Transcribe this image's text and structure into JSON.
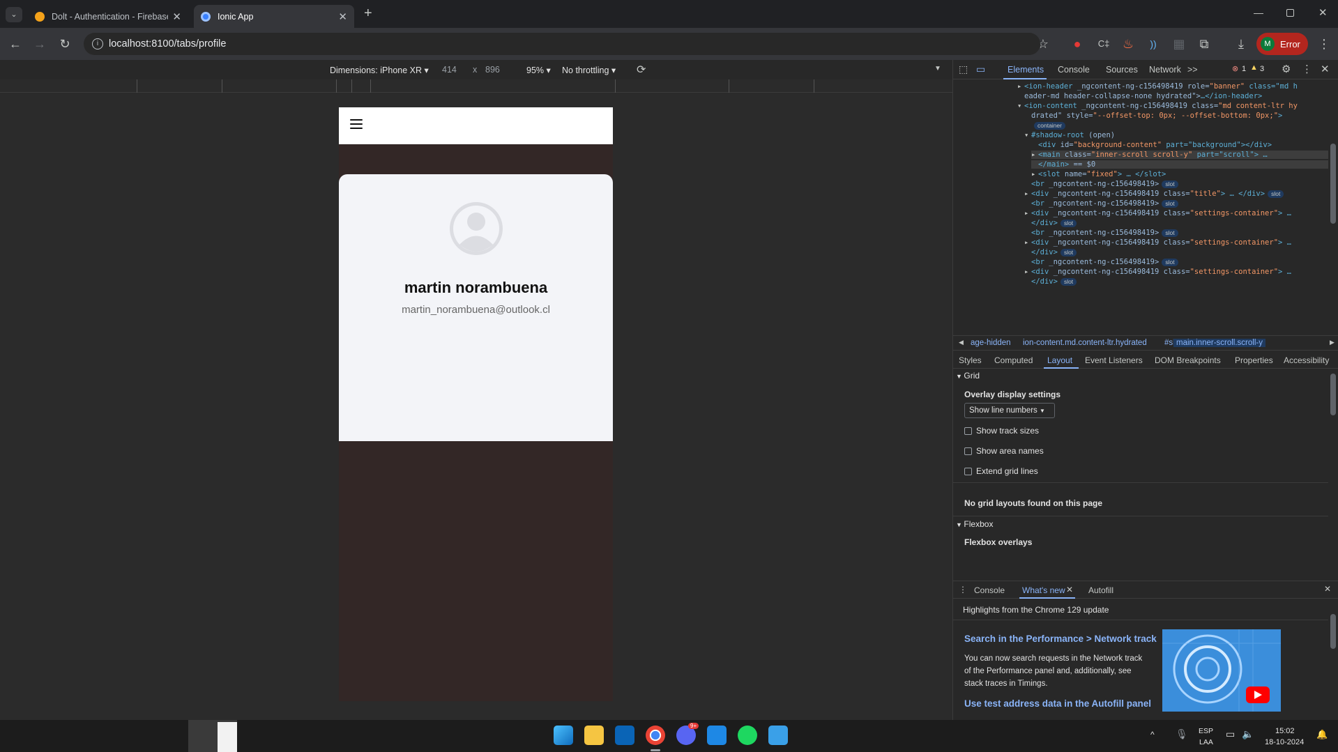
{
  "browser": {
    "tabs": [
      {
        "title": "Dolt - Authentication - Firebase",
        "active": false
      },
      {
        "title": "Ionic App",
        "active": true
      }
    ],
    "new_tab_symbol": "+",
    "url": "localhost:8100/tabs/profile",
    "profile_initial": "M",
    "profile_status": "Error"
  },
  "device_toolbar": {
    "device": "Dimensions: iPhone XR ▾",
    "width": "414",
    "times": "x",
    "height": "896",
    "zoom": "95% ▾",
    "throttling": "No throttling ▾"
  },
  "app": {
    "user_name": "martin norambuena",
    "user_email": "martin_norambuena@outlook.cl"
  },
  "devtools": {
    "tabs": [
      "Elements",
      "Console",
      "Sources",
      "Network"
    ],
    "more_tabs": ">>",
    "error_count": "1",
    "warning_count": "3",
    "breadcrumbs": [
      "age-hidden",
      "ion-content.md.content-ltr.hydrated",
      "#shadow-root",
      "main.inner-scroll.scroll-y"
    ],
    "subtabs": [
      "Styles",
      "Computed",
      "Layout",
      "Event Listeners",
      "DOM Breakpoints",
      "Properties",
      "Accessibility"
    ],
    "layout": {
      "grid_header": "Grid",
      "overlay_title": "Overlay display settings",
      "select_value": "Show line numbers",
      "checkboxes": [
        "Show track sizes",
        "Show area names",
        "Extend grid lines"
      ],
      "no_grid": "No grid layouts found on this page",
      "flexbox_header": "Flexbox",
      "flexbox_overlays": "Flexbox overlays"
    },
    "drawer_tabs": [
      "Console",
      "What's new",
      "Autofill"
    ],
    "whatsnew": {
      "highlights": "Highlights from the Chrome 129 update",
      "item1_title": "Search in the Performance > Network track",
      "item1_body": "You can now search requests in the Network track of the Performance panel and, additionally, see stack traces in Timings.",
      "item2_title": "Use test address data in the Autofill panel"
    },
    "dom": [
      {
        "pre": "▸",
        "tag": "<ion-header",
        "attrs": " _ngcontent-ng-c156498419 role=",
        "val": "\"banner\"",
        "rest": " class=\"md h"
      },
      {
        "pre": "",
        "tag": "",
        "attrs": "eader-md header-collapse-none hydrated\">",
        "val": "",
        "rest": "…</ion-header>"
      },
      {
        "pre": "▾",
        "tag": "<ion-content",
        "attrs": " _ngcontent-ng-c156498419 class=",
        "val": "\"md content-ltr hy",
        "rest": ""
      },
      {
        "pre": "",
        "tag": "",
        "attrs": "drated\" style=",
        "val": "\"--offset-top: 0px; --offset-bottom: 0px;\"",
        "rest": ">"
      },
      {
        "pre": "",
        "tag": "",
        "attrs": "",
        "val": "",
        "rest": "",
        "badge": "container"
      },
      {
        "pre": "▾",
        "tag": "#shadow-root",
        "attrs": " (open)",
        "val": "",
        "rest": ""
      },
      {
        "pre": "",
        "tag": "<div",
        "attrs": " id=",
        "val": "\"background-content\"",
        "rest": " part=\"background\"></div>"
      },
      {
        "pre": "▸",
        "tag": "<main",
        "attrs": " class=",
        "val": "\"inner-scroll scroll-y\"",
        "rest": " part=\"scroll\"> …"
      },
      {
        "pre": "",
        "tag": "</main>",
        "attrs": " == $0",
        "val": "",
        "rest": ""
      },
      {
        "pre": "▸",
        "tag": "<slot",
        "attrs": " name=",
        "val": "\"fixed\"",
        "rest": "> … </slot>"
      },
      {
        "pre": "",
        "tag": "<br",
        "attrs": " _ngcontent-ng-c156498419>",
        "val": "",
        "rest": "",
        "badge": "slot"
      },
      {
        "pre": "▸",
        "tag": "<div",
        "attrs": " _ngcontent-ng-c156498419 class=",
        "val": "\"title\"",
        "rest": "> … </div>",
        "badge": "slot"
      },
      {
        "pre": "",
        "tag": "<br",
        "attrs": " _ngcontent-ng-c156498419>",
        "val": "",
        "rest": "",
        "badge": "slot"
      },
      {
        "pre": "▸",
        "tag": "<div",
        "attrs": " _ngcontent-ng-c156498419 class=",
        "val": "\"settings-container\"",
        "rest": "> …"
      },
      {
        "pre": "",
        "tag": "</div>",
        "attrs": "",
        "val": "",
        "rest": "",
        "badge": "slot"
      },
      {
        "pre": "",
        "tag": "<br",
        "attrs": " _ngcontent-ng-c156498419>",
        "val": "",
        "rest": "",
        "badge": "slot"
      },
      {
        "pre": "▸",
        "tag": "<div",
        "attrs": " _ngcontent-ng-c156498419 class=",
        "val": "\"settings-container\"",
        "rest": "> …"
      },
      {
        "pre": "",
        "tag": "</div>",
        "attrs": "",
        "val": "",
        "rest": "",
        "badge": "slot"
      },
      {
        "pre": "",
        "tag": "<br",
        "attrs": " _ngcontent-ng-c156498419>",
        "val": "",
        "rest": "",
        "badge": "slot"
      },
      {
        "pre": "▸",
        "tag": "<div",
        "attrs": " _ngcontent-ng-c156498419 class=",
        "val": "\"settings-container\"",
        "rest": "> …"
      },
      {
        "pre": "",
        "tag": "</div>",
        "attrs": "",
        "val": "",
        "rest": "",
        "badge": "slot"
      }
    ]
  },
  "taskbar": {
    "lang": "ESP",
    "lang_sub": "LAA",
    "time": "15:02",
    "date": "18-10-2024",
    "discord_badge": "9+"
  }
}
